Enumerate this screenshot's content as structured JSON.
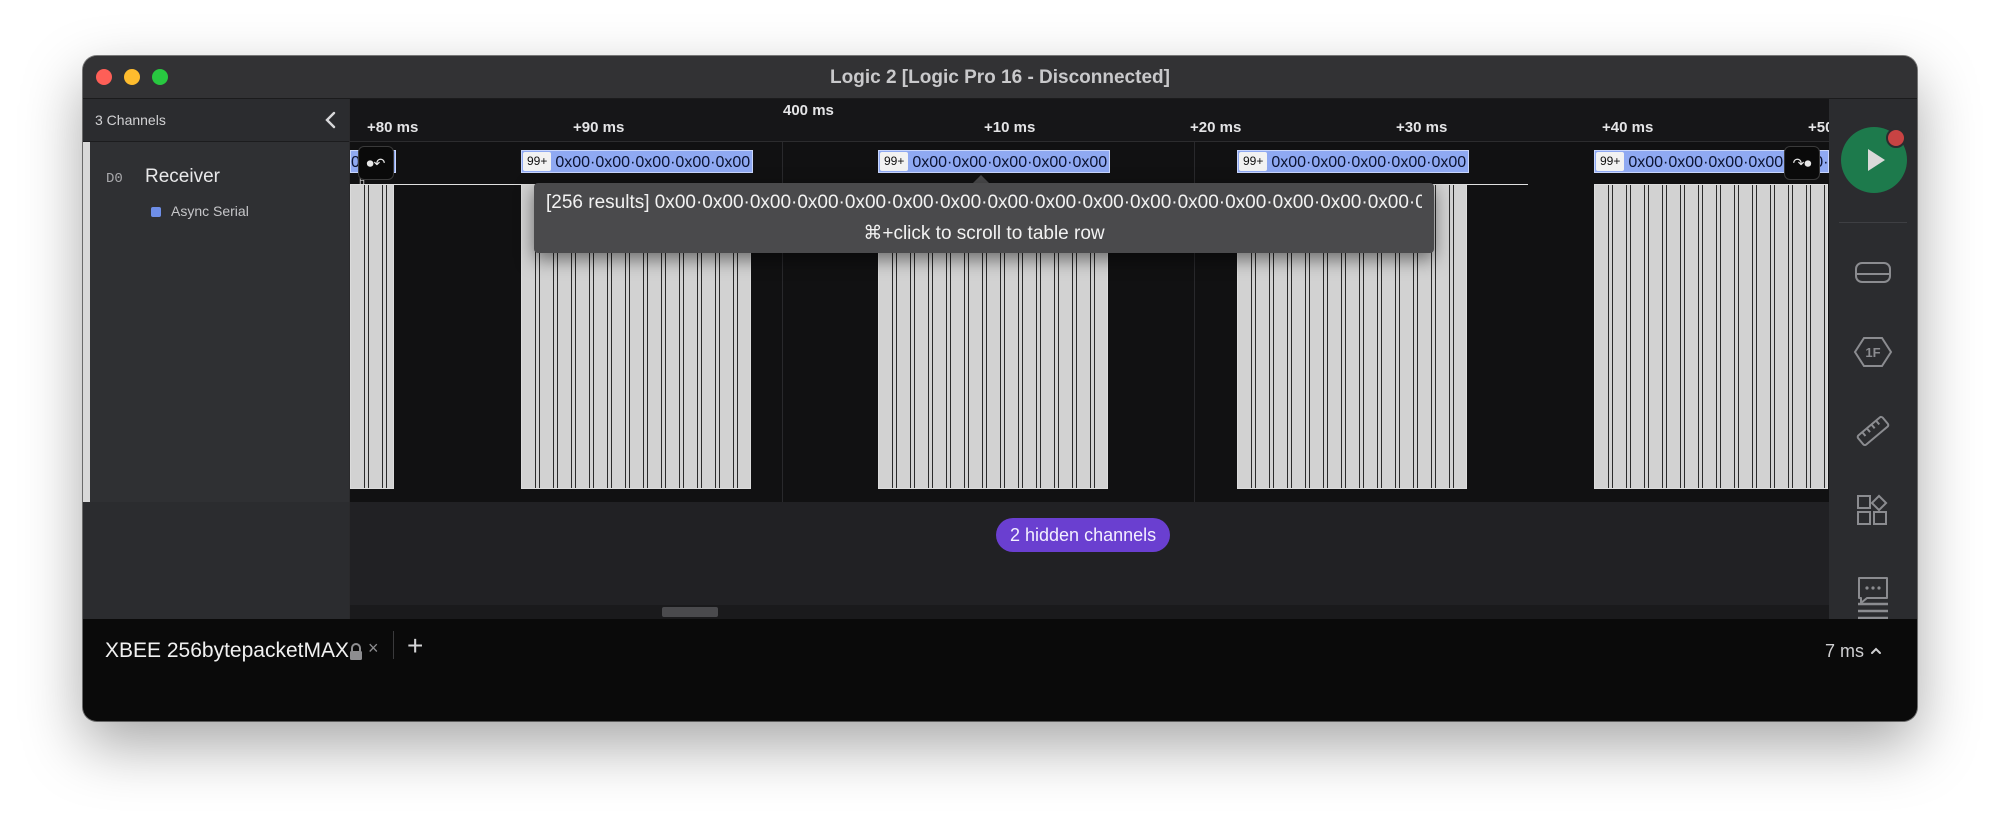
{
  "window": {
    "title": "Logic 2 [Logic Pro 16 - Disconnected]"
  },
  "sidebar": {
    "channels_count": "3 Channels",
    "channel": {
      "id": "D0",
      "name": "Receiver",
      "analyzer": "Async Serial"
    }
  },
  "ruler": {
    "major_label": "400 ms",
    "ticks": [
      "+80 ms",
      "+90 ms",
      "+10 ms",
      "+20 ms",
      "+30 ms",
      "+40 ms",
      "+50"
    ]
  },
  "decodes": {
    "badge": "99+",
    "text": "0x00·0x00·0x00·0x00·0x00·0x00",
    "first_text": "0x00",
    "left_edge_icon": "⏺↶",
    "right_edge_icon": "↷⏺"
  },
  "tooltip": {
    "line1": "[256 results] 0x00·0x00·0x00·0x00·0x00·0x00·0x00·0x00·0x00·0x00·0x00·0x00·0x00·0x00·0x00·0x00·0x00·...",
    "line2": "⌘+click to scroll to table row"
  },
  "signal_levels": {
    "high": "H",
    "low": "L"
  },
  "hidden_channels": "2 hidden channels",
  "tabbar": {
    "capture_name": "XBEE 256bytepacketMAX",
    "close_glyph": "×",
    "add_glyph": "+",
    "duration": "7 ms"
  },
  "colors": {
    "run_button": "#1d7a4c",
    "decode_bubble": "#8fa9f2",
    "hidden_pill": "#6a3fd0",
    "analyzer_dot": "#6e8ee8"
  },
  "icons": {
    "collapse": "chevron-left-icon",
    "run": "play-icon",
    "device": "device-icon",
    "trigger": "1f-hexagon-icon",
    "measure": "ruler-icon",
    "extensions": "extensions-icon",
    "annotations": "comment-icon",
    "menu": "hamburger-menu-icon",
    "lock": "lock-icon",
    "expand": "chevron-up-icon"
  }
}
